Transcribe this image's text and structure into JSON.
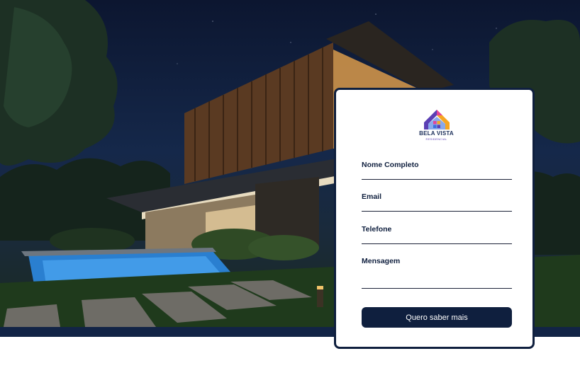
{
  "brand": {
    "name": "BELA VISTA",
    "tagline": "RESIDENCIAL",
    "colors": {
      "navy": "#0f1f3e",
      "purple": "#5b3fb4",
      "orange": "#f5a623",
      "pink": "#e2449a",
      "blue": "#3a6fe0"
    }
  },
  "hero": {
    "image": "night-modern-house-with-pool"
  },
  "form": {
    "fields": [
      {
        "label": "Nome Completo",
        "value": ""
      },
      {
        "label": "Email",
        "value": ""
      },
      {
        "label": "Telefone",
        "value": ""
      },
      {
        "label": "Mensagem",
        "value": ""
      }
    ],
    "submit_label": "Quero saber mais"
  }
}
